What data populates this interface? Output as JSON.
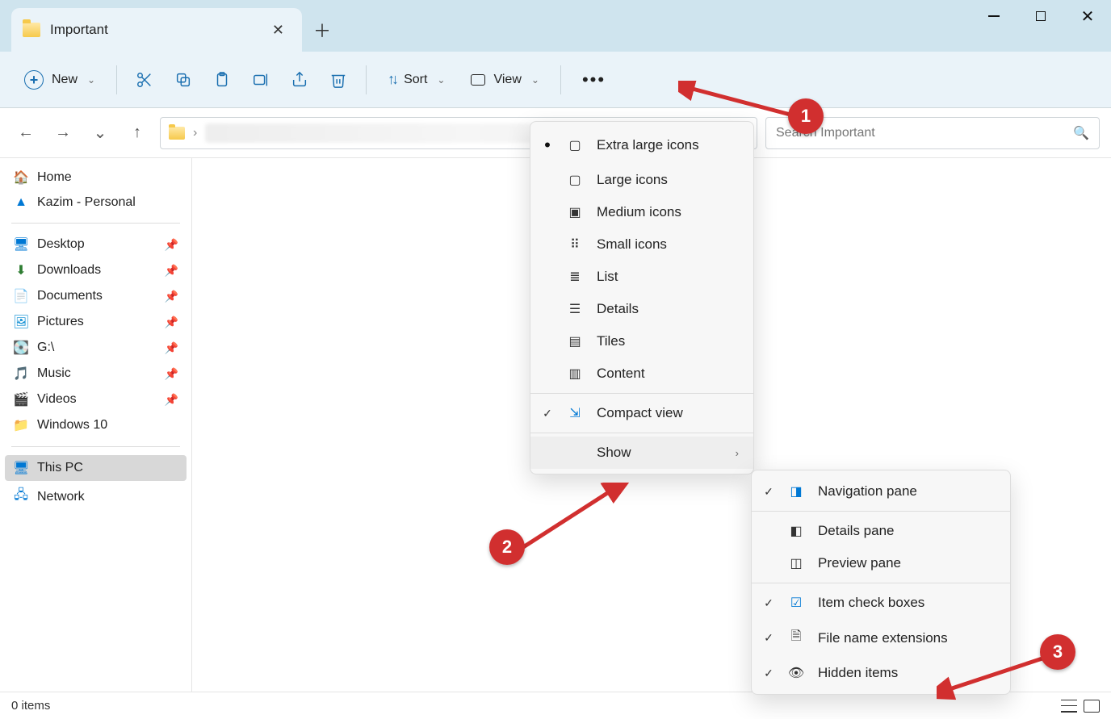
{
  "tab": {
    "title": "Important"
  },
  "toolbar": {
    "new_label": "New",
    "sort_label": "Sort",
    "view_label": "View"
  },
  "search": {
    "placeholder": "Search Important"
  },
  "sidebar": {
    "home": "Home",
    "onedrive": "Kazim - Personal",
    "quick": [
      {
        "label": "Desktop"
      },
      {
        "label": "Downloads"
      },
      {
        "label": "Documents"
      },
      {
        "label": "Pictures"
      },
      {
        "label": "G:\\"
      },
      {
        "label": "Music"
      },
      {
        "label": "Videos"
      },
      {
        "label": "Windows 10"
      }
    ],
    "thispc": "This PC",
    "network": "Network"
  },
  "view_menu": {
    "xl": "Extra large icons",
    "large": "Large icons",
    "medium": "Medium icons",
    "small": "Small icons",
    "list": "List",
    "details": "Details",
    "tiles": "Tiles",
    "content": "Content",
    "compact": "Compact view",
    "show": "Show"
  },
  "show_menu": {
    "nav": "Navigation pane",
    "details": "Details pane",
    "preview": "Preview pane",
    "checkboxes": "Item check boxes",
    "ext": "File name extensions",
    "hidden": "Hidden items"
  },
  "status": {
    "count": "0 items"
  },
  "annotations": {
    "b1": "1",
    "b2": "2",
    "b3": "3"
  }
}
